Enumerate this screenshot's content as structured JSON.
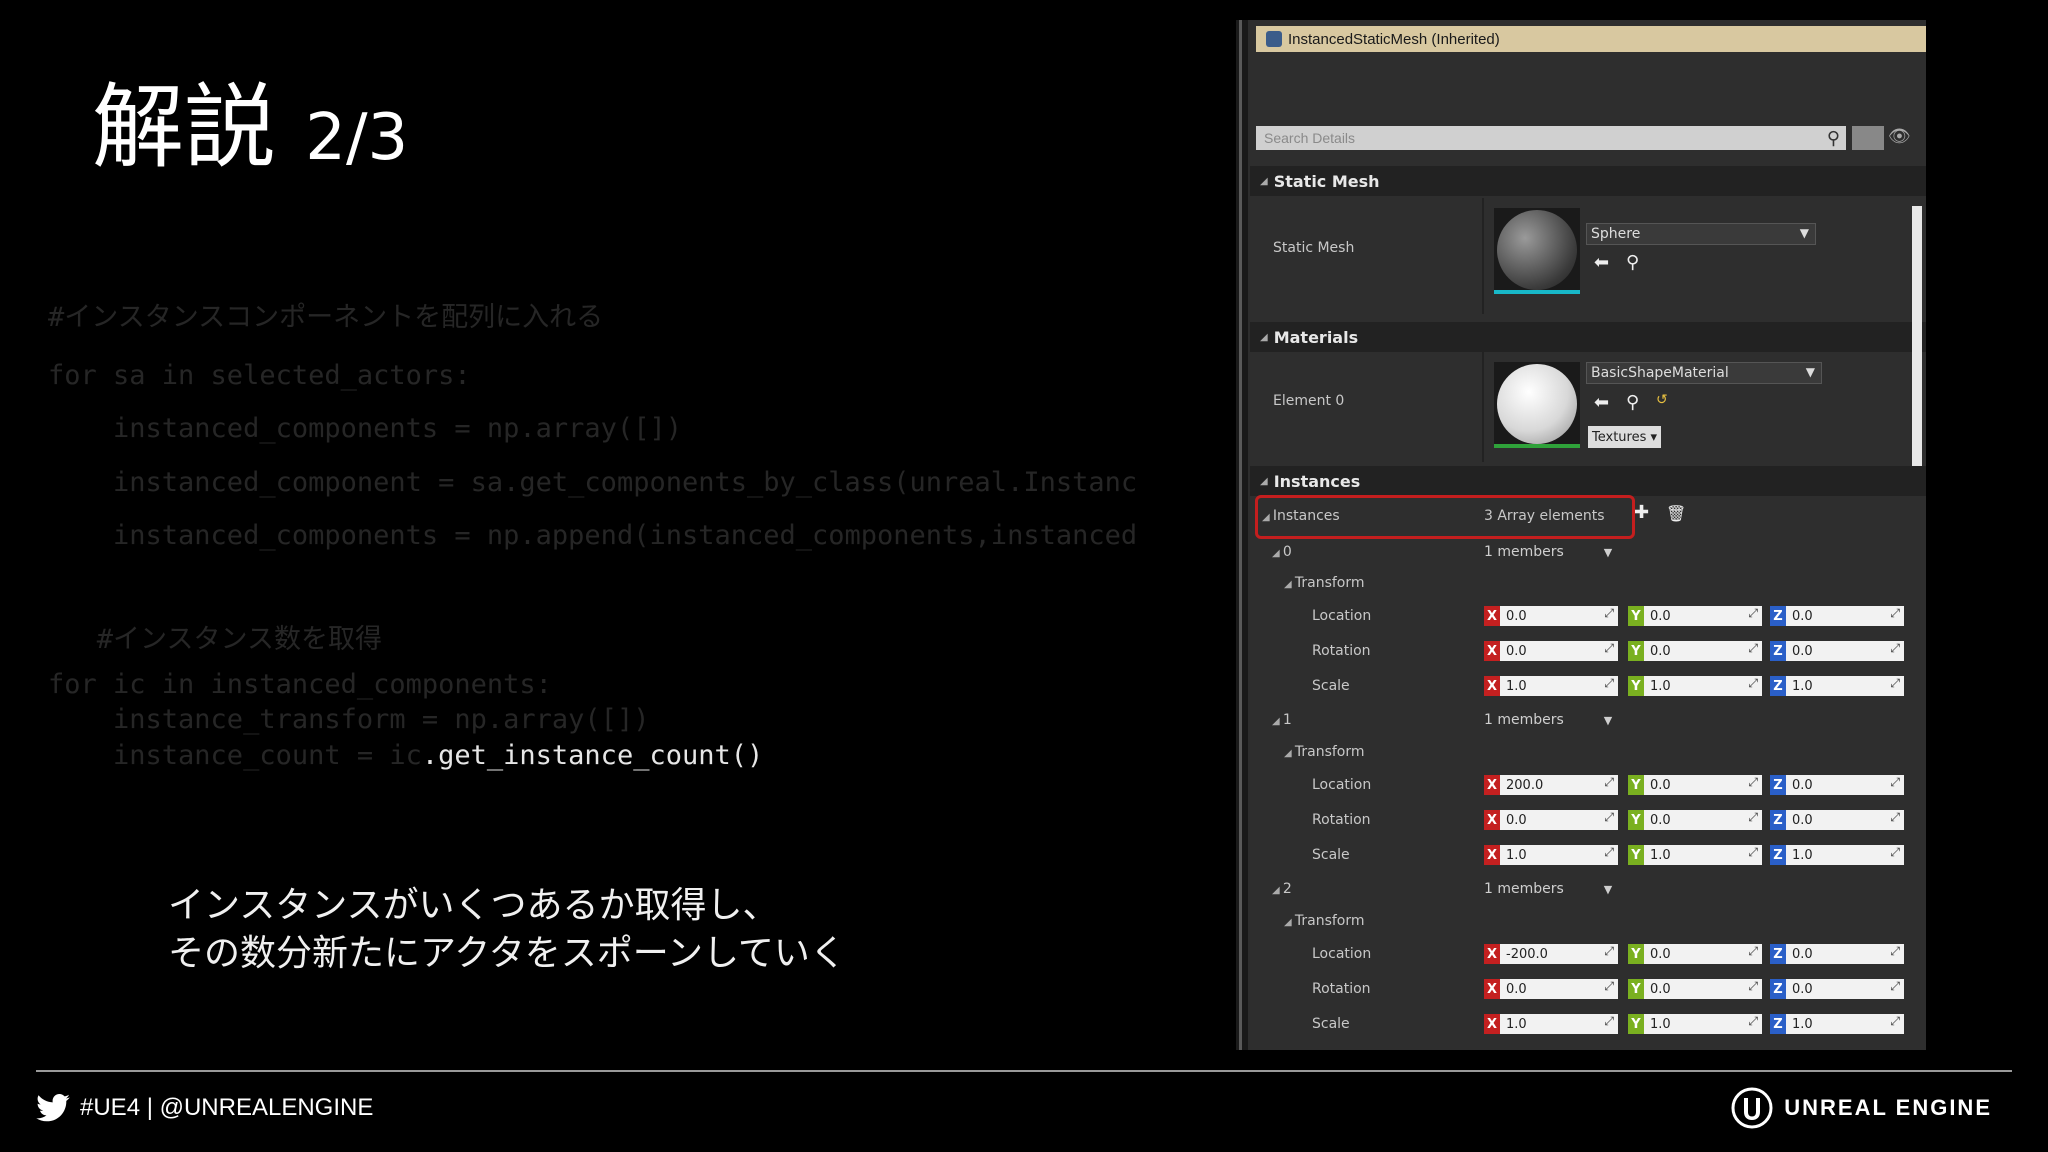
{
  "slide": {
    "title_main": "解説",
    "title_num": "2/3",
    "caption_line1": "インスタンスがいくつあるか取得し、",
    "caption_line2": "その数分新たにアクタをスポーンしていく"
  },
  "code": {
    "line1": "#インスタンスコンポーネントを配列に入れる",
    "line2": "for sa in selected_actors:",
    "line3": "    instanced_components = np.array([])",
    "line4": "    instanced_component = sa.get_components_by_class(unreal.Instanc",
    "line5": "    instanced_components = np.append(instanced_components,instanced",
    "line6": "   #インスタンス数を取得",
    "line7": "for ic in instanced_components:",
    "line8": "    instance_transform = np.array([])",
    "line9_dim": "    instance_count = ic",
    "line9_hl": ".get_instance_count()"
  },
  "footer": {
    "hashtag": "#UE4 | @UNREALENGINE",
    "brand": "UNREAL ENGINE"
  },
  "panel": {
    "component_title": "InstancedStaticMesh (Inherited)",
    "search_placeholder": "Search Details",
    "cat_static_mesh": "Static Mesh",
    "label_static_mesh": "Static Mesh",
    "mesh_value": "Sphere",
    "cat_materials": "Materials",
    "label_element0": "Element 0",
    "material_value": "BasicShapeMaterial",
    "textures_btn": "Textures ▾",
    "cat_instances": "Instances",
    "label_instances": "Instances",
    "instances_value": "3 Array elements",
    "instances": [
      {
        "index": "0",
        "members": "1 members",
        "transform": "Transform",
        "rows": [
          {
            "label": "Location",
            "x": "0.0",
            "y": "0.0",
            "z": "0.0"
          },
          {
            "label": "Rotation",
            "x": "0.0",
            "y": "0.0",
            "z": "0.0"
          },
          {
            "label": "Scale",
            "x": "1.0",
            "y": "1.0",
            "z": "1.0"
          }
        ]
      },
      {
        "index": "1",
        "members": "1 members",
        "transform": "Transform",
        "rows": [
          {
            "label": "Location",
            "x": "200.0",
            "y": "0.0",
            "z": "0.0"
          },
          {
            "label": "Rotation",
            "x": "0.0",
            "y": "0.0",
            "z": "0.0"
          },
          {
            "label": "Scale",
            "x": "1.0",
            "y": "1.0",
            "z": "1.0"
          }
        ]
      },
      {
        "index": "2",
        "members": "1 members",
        "transform": "Transform",
        "rows": [
          {
            "label": "Location",
            "x": "-200.0",
            "y": "0.0",
            "z": "0.0"
          },
          {
            "label": "Rotation",
            "x": "0.0",
            "y": "0.0",
            "z": "0.0"
          },
          {
            "label": "Scale",
            "x": "1.0",
            "y": "1.0",
            "z": "1.0"
          }
        ]
      }
    ],
    "axis_x": "X",
    "axis_y": "Y",
    "axis_z": "Z",
    "colors": {
      "x": "#c42020",
      "y": "#7ab020",
      "z": "#2a5fc8",
      "highlight": "#c41e1e"
    }
  }
}
